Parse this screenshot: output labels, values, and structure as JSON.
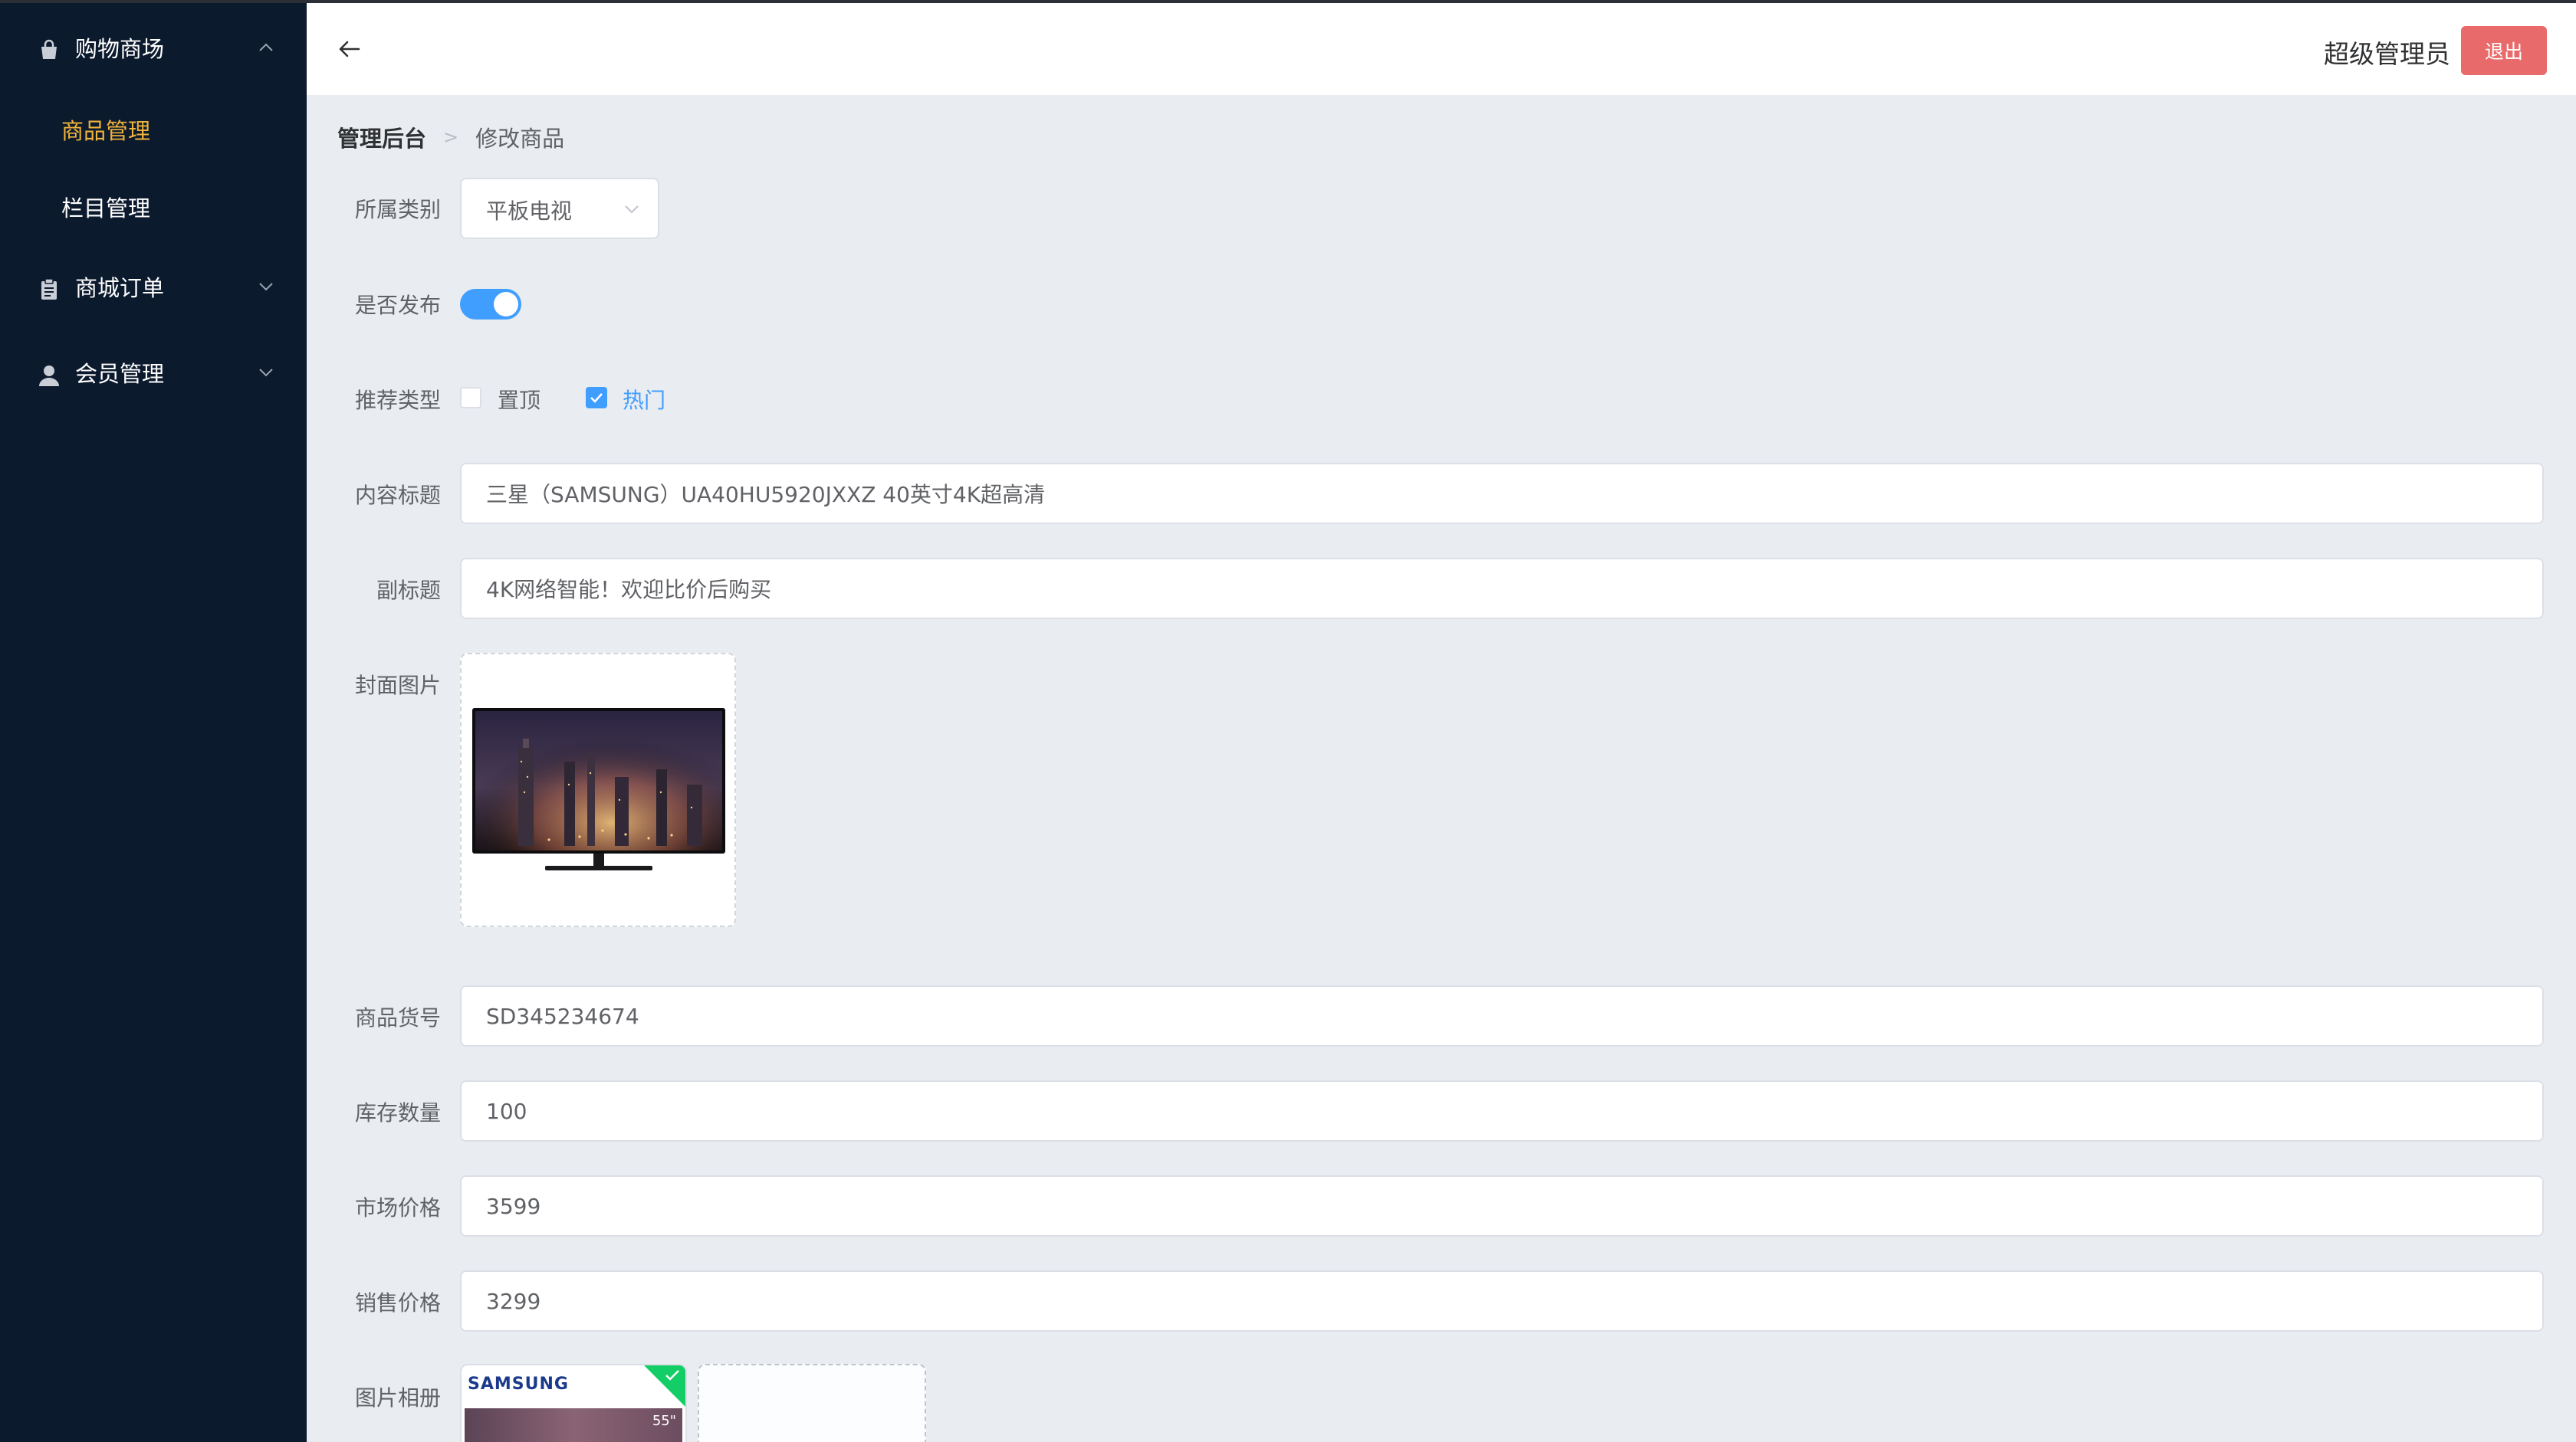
{
  "sidebar": {
    "groups": [
      {
        "label": "购物商场",
        "icon": "shopping-bag-icon",
        "expanded": true
      },
      {
        "label": "商城订单",
        "icon": "clipboard-icon",
        "expanded": false
      },
      {
        "label": "会员管理",
        "icon": "user-icon",
        "expanded": false
      }
    ],
    "submenu": [
      {
        "label": "商品管理",
        "active": true
      },
      {
        "label": "栏目管理",
        "active": false
      }
    ]
  },
  "header": {
    "back_icon": "arrow-left-icon",
    "admin_name": "超级管理员",
    "logout_label": "退出"
  },
  "breadcrumb": {
    "home": "管理后台",
    "separator": ">",
    "current": "修改商品"
  },
  "form": {
    "category": {
      "label": "所属类别",
      "value": "平板电视"
    },
    "publish": {
      "label": "是否发布",
      "on": true
    },
    "recommend": {
      "label": "推荐类型",
      "options": [
        {
          "label": "置顶",
          "checked": false
        },
        {
          "label": "热门",
          "checked": true
        }
      ]
    },
    "title": {
      "label": "内容标题",
      "value": "三星（SAMSUNG）UA40HU5920JXXZ 40英寸4K超高清"
    },
    "subtitle": {
      "label": "副标题",
      "value": "4K网络智能！欢迎比价后购买"
    },
    "cover": {
      "label": "封面图片"
    },
    "sku": {
      "label": "商品货号",
      "value": "SD345234674"
    },
    "stock": {
      "label": "库存数量",
      "value": "100"
    },
    "market_price": {
      "label": "市场价格",
      "value": "3599"
    },
    "sale_price": {
      "label": "销售价格",
      "value": "3299"
    },
    "gallery": {
      "label": "图片相册",
      "brand_text": "SAMSUNG",
      "size_text": "55\""
    }
  },
  "colors": {
    "sidebar_bg": "#0c1a2e",
    "active_menu": "#f0b33b",
    "primary": "#409eff",
    "danger": "#e86a6a",
    "success": "#13ce66"
  }
}
